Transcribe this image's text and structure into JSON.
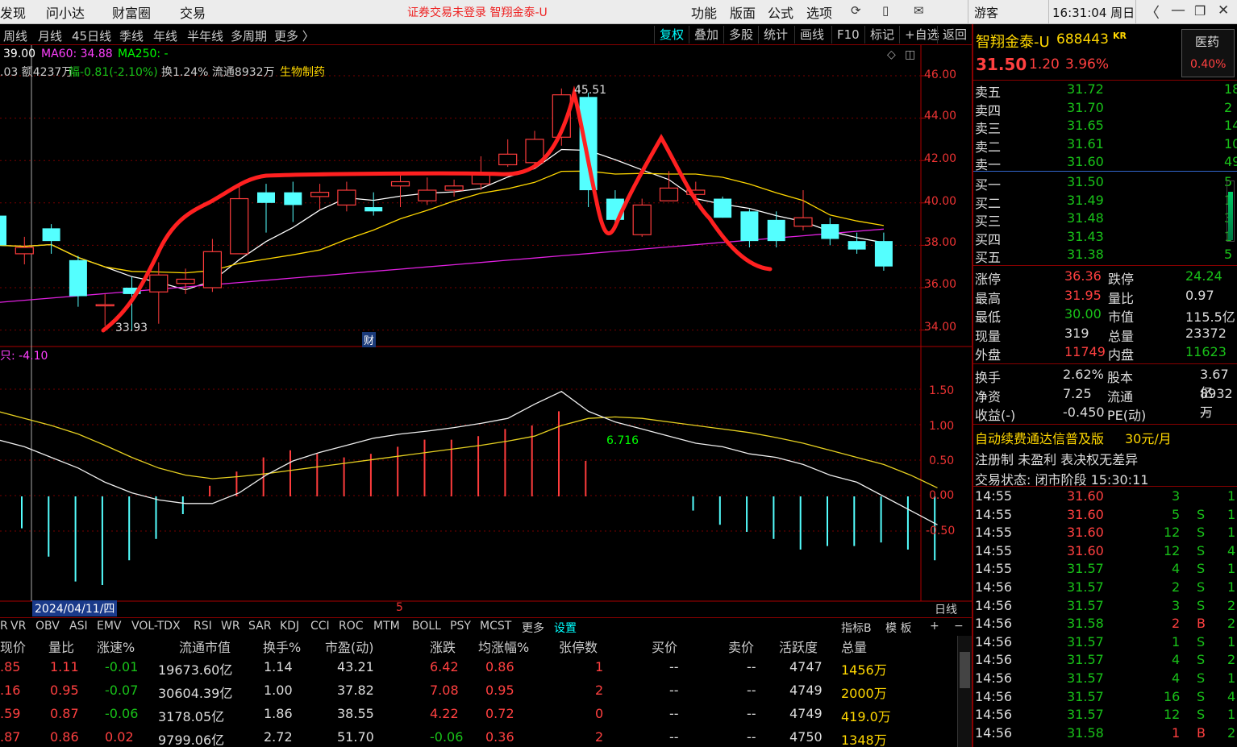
{
  "menu": {
    "items": [
      "发现",
      "问小达",
      "财富圈",
      "交易"
    ],
    "notice": "证券交易未登录  智翔金泰-U",
    "right": [
      "功能",
      "版面",
      "公式",
      "选项"
    ],
    "user": "游客",
    "clock": "16:31:04 周日"
  },
  "periods": [
    "周线",
    "月线",
    "45日线",
    "季线",
    "年线",
    "半年线",
    "多周期",
    "更多 〉"
  ],
  "tools": [
    "复权",
    "叠加",
    "多股",
    "统计",
    "画线",
    "F10",
    "标记",
    "+自选",
    "返回"
  ],
  "chart_info": {
    "ma": "39.00",
    "ma60": "MA60: 34.88",
    "ma250": "MA250: -",
    "line2_a": ".03 额4237万",
    "line2_b": "幅-0.81(-2.10%)",
    "line2_c": "换1.24% 流通8932万",
    "industry": "生物制药",
    "peak": "45.51",
    "low": "33.93",
    "cai": "财",
    "cursor_date": "2024/04/11/四",
    "mark5": "5",
    "osc_val": "6.716",
    "osc_label": "只: -4.10",
    "daily": "日线"
  },
  "price_axis": [
    "46.00",
    "44.00",
    "42.00",
    "40.00",
    "38.00",
    "36.00",
    "34.00"
  ],
  "osc_axis": [
    "1.50",
    "1.00",
    "0.50",
    "0.00",
    "-0.50"
  ],
  "indicators": [
    "R",
    "VR",
    "OBV",
    "ASI",
    "EMV",
    "VOL-TDX",
    "RSI",
    "WR",
    "SAR",
    "KDJ",
    "CCI",
    "ROC",
    "MTM",
    "BOLL",
    "PSY",
    "MCST",
    "更多",
    "设置"
  ],
  "ind_right": [
    "指标B",
    "模 板",
    "+",
    "−"
  ],
  "table": {
    "headers": [
      "现价",
      "量比",
      "涨速%",
      "流通市值",
      "换手%",
      "市盈(动)",
      "涨跌",
      "均涨幅%",
      "张停数",
      "买价",
      "卖价",
      "活跃度",
      "总量"
    ],
    "rows": [
      [
        ".85",
        "1.11",
        "-0.01",
        "19673.60亿",
        "1.14",
        "43.21",
        "6.42",
        "0.86",
        "1",
        "--",
        "--",
        "4747",
        "1456万"
      ],
      [
        ".16",
        "0.95",
        "-0.07",
        "30604.39亿",
        "1.00",
        "37.82",
        "7.08",
        "0.95",
        "2",
        "--",
        "--",
        "4749",
        "2000万"
      ],
      [
        ".59",
        "0.87",
        "-0.06",
        "3178.05亿",
        "1.86",
        "38.55",
        "4.22",
        "0.72",
        "0",
        "--",
        "--",
        "4749",
        "419.0万"
      ],
      [
        ".87",
        "0.86",
        "0.02",
        "9799.06亿",
        "2.72",
        "51.70",
        "-0.06",
        "0.36",
        "2",
        "--",
        "--",
        "4750",
        "1348万"
      ]
    ]
  },
  "stock": {
    "name": "智翔金泰-U",
    "code": "688443",
    "tag": "KR",
    "price": "31.50",
    "chg": "1.20",
    "pct": "3.96%",
    "sector": "医药",
    "sector_pct": "0.40%"
  },
  "asks": [
    [
      "卖五",
      "31.72",
      "18"
    ],
    [
      "卖四",
      "31.70",
      "2"
    ],
    [
      "卖三",
      "31.65",
      "14"
    ],
    [
      "卖二",
      "31.61",
      "10"
    ],
    [
      "卖一",
      "31.60",
      "49"
    ]
  ],
  "bids": [
    [
      "买一",
      "31.50",
      "5"
    ],
    [
      "买二",
      "31.49",
      "1"
    ],
    [
      "买三",
      "31.48",
      "3"
    ],
    [
      "买四",
      "31.43",
      "1"
    ],
    [
      "买五",
      "31.38",
      "5"
    ]
  ],
  "stats": [
    [
      "涨停",
      "36.36",
      "跌停",
      "24.24"
    ],
    [
      "最高",
      "31.95",
      "量比",
      "0.97"
    ],
    [
      "最低",
      "30.00",
      "市值",
      "115.5亿"
    ],
    [
      "现量",
      "319",
      "总量",
      "23372"
    ],
    [
      "外盘",
      "11749",
      "内盘",
      "11623"
    ]
  ],
  "stats2": [
    [
      "换手",
      "2.62%",
      "股本",
      "3.67亿"
    ],
    [
      "净资",
      "7.25",
      "流通",
      "8932万"
    ],
    [
      "收益(-)",
      "-0.450",
      "PE(动)",
      "--"
    ]
  ],
  "promo": {
    "a": "自动续费通达信普及版",
    "b": "30元/月"
  },
  "reg": "注册制 未盈利 表决权无差异",
  "status": "交易状态: 闭市阶段 15:30:11",
  "ticks": [
    [
      "14:55",
      "31.60",
      "3",
      "",
      "1"
    ],
    [
      "14:55",
      "31.60",
      "5",
      "S",
      "1"
    ],
    [
      "14:55",
      "31.60",
      "12",
      "S",
      "1"
    ],
    [
      "14:55",
      "31.60",
      "12",
      "S",
      "4"
    ],
    [
      "14:55",
      "31.57",
      "4",
      "S",
      "1"
    ],
    [
      "14:56",
      "31.57",
      "2",
      "S",
      "1"
    ],
    [
      "14:56",
      "31.57",
      "3",
      "S",
      "2"
    ],
    [
      "14:56",
      "31.58",
      "2",
      "B",
      "2"
    ],
    [
      "14:56",
      "31.57",
      "1",
      "S",
      "1"
    ],
    [
      "14:56",
      "31.57",
      "4",
      "S",
      "2"
    ],
    [
      "14:56",
      "31.57",
      "4",
      "S",
      "1"
    ],
    [
      "14:56",
      "31.57",
      "16",
      "S",
      "4"
    ],
    [
      "14:56",
      "31.57",
      "12",
      "S",
      "1"
    ],
    [
      "14:56",
      "31.58",
      "1",
      "B",
      "2"
    ]
  ],
  "chart_data": {
    "type": "candlestick",
    "price_range": [
      33.5,
      46.5
    ],
    "candles": [
      [
        39.4,
        38.0,
        39.8,
        37.6
      ],
      [
        37.6,
        37.9,
        38.4,
        37.1
      ],
      [
        38.8,
        38.2,
        39.0,
        37.6
      ],
      [
        37.3,
        35.6,
        37.5,
        35.1
      ],
      [
        35.2,
        35.2,
        35.7,
        34.2
      ],
      [
        36.0,
        35.7,
        36.5,
        34.0
      ],
      [
        35.8,
        36.6,
        37.2,
        34.3
      ],
      [
        36.2,
        36.4,
        36.9,
        35.7
      ],
      [
        36.0,
        37.7,
        38.3,
        35.8
      ],
      [
        37.6,
        40.2,
        40.8,
        37.6
      ],
      [
        40.5,
        40.0,
        40.9,
        38.6
      ],
      [
        40.5,
        39.9,
        41.0,
        39.1
      ],
      [
        40.3,
        40.5,
        40.9,
        39.7
      ],
      [
        39.9,
        40.6,
        41.0,
        39.6
      ],
      [
        39.8,
        39.6,
        40.5,
        39.4
      ],
      [
        40.8,
        41.0,
        41.4,
        39.8
      ],
      [
        40.1,
        40.6,
        41.2,
        39.9
      ],
      [
        40.6,
        40.8,
        41.1,
        40.3
      ],
      [
        40.9,
        41.4,
        42.2,
        40.6
      ],
      [
        41.8,
        42.3,
        43.0,
        41.7
      ],
      [
        41.9,
        43.0,
        43.4,
        41.8
      ],
      [
        43.1,
        45.1,
        45.4,
        42.7
      ],
      [
        45.0,
        40.6,
        45.2,
        39.8
      ],
      [
        40.2,
        39.2,
        40.6,
        38.8
      ],
      [
        38.5,
        39.9,
        40.2,
        38.4
      ],
      [
        40.1,
        40.7,
        41.5,
        40.3
      ],
      [
        40.4,
        40.6,
        41.0,
        39.9
      ],
      [
        40.2,
        39.3,
        40.3,
        39.3
      ],
      [
        39.6,
        38.2,
        39.7,
        37.9
      ],
      [
        39.2,
        38.2,
        39.6,
        37.9
      ],
      [
        38.9,
        39.3,
        40.6,
        38.7
      ],
      [
        39.0,
        38.3,
        39.3,
        38.0
      ],
      [
        38.2,
        37.8,
        38.6,
        37.6
      ],
      [
        38.2,
        37.0,
        38.6,
        36.8
      ]
    ],
    "osc_range": [
      -0.8,
      1.75
    ],
    "osc_bars": [
      -0.45,
      -0.85,
      -1.2,
      -1.25,
      -0.9,
      -0.6,
      -0.25,
      0.15,
      0.35,
      0.55,
      0.65,
      0.6,
      0.55,
      0.6,
      0.7,
      0.8,
      0.8,
      0.85,
      0.95,
      1.0,
      1.2,
      0.5,
      0.0,
      0.0,
      0.0,
      -0.2,
      -0.4,
      -0.5,
      -0.6,
      -0.75,
      -0.7,
      -0.7,
      -0.65,
      -0.75,
      -0.9
    ],
    "osc_white": [
      0.8,
      0.7,
      0.55,
      0.4,
      0.2,
      0.05,
      -0.05,
      -0.1,
      -0.1,
      0.05,
      0.3,
      0.5,
      0.62,
      0.72,
      0.82,
      0.88,
      0.92,
      0.97,
      1.03,
      1.1,
      1.3,
      1.48,
      1.2,
      1.05,
      0.95,
      0.85,
      0.75,
      0.7,
      0.6,
      0.55,
      0.45,
      0.3,
      0.2,
      0.0,
      -0.2,
      -0.4
    ],
    "osc_yellow": [
      1.2,
      1.1,
      1.0,
      0.88,
      0.72,
      0.55,
      0.4,
      0.3,
      0.25,
      0.28,
      0.32,
      0.37,
      0.42,
      0.47,
      0.52,
      0.57,
      0.62,
      0.67,
      0.72,
      0.78,
      0.85,
      1.0,
      1.1,
      1.12,
      1.1,
      1.05,
      1.0,
      0.95,
      0.9,
      0.83,
      0.75,
      0.65,
      0.55,
      0.45,
      0.3,
      0.12
    ]
  }
}
